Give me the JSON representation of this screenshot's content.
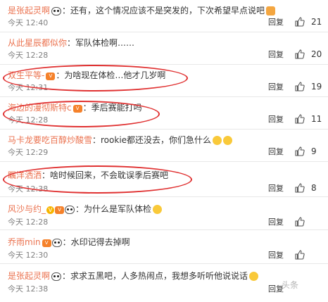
{
  "comments": [
    {
      "user": "是张起灵啊",
      "text": "：还有，这个情况应该不是突发的，下次希望早点说吧",
      "time": "今天 12:40",
      "reply": "回复",
      "likes": "21",
      "badges": [
        "panda"
      ],
      "emoji": "pray"
    },
    {
      "user": "从此星辰都似你",
      "text": "：军队体检啊……",
      "time": "今天 12:28",
      "reply": "回复",
      "likes": "20",
      "badges": [],
      "emoji": ""
    },
    {
      "user": "双生平等-",
      "text": "：为啥现在体检…他才几岁啊",
      "time": "今天 12:31",
      "reply": "回复",
      "likes": "19",
      "badges": [
        "vip"
      ],
      "emoji": ""
    },
    {
      "user": "海边的漫彻斯特c",
      "text": "：季后赛能打吗",
      "time": "今天 12:28",
      "reply": "回复",
      "likes": "11",
      "badges": [
        "vip"
      ],
      "emoji": ""
    },
    {
      "user": "马卡龙要吃百醇炒酸雪",
      "text": "：rookie都还没去，你们急什么",
      "time": "今天 12:29",
      "reply": "回复",
      "likes": "9",
      "badges": [],
      "emoji": "double"
    },
    {
      "user": "瞩洋洒洒",
      "text": "：啥时候回来，不会耽误季后赛吧",
      "time": "今天 12:38",
      "reply": "回复",
      "likes": "8",
      "badges": [],
      "emoji": ""
    },
    {
      "user": "风沙与约_",
      "text": "：为什么是军队体检",
      "time": "今天 12:28",
      "reply": "回复",
      "likes": "",
      "badges": [
        "v",
        "vip",
        "panda"
      ],
      "emoji": "face"
    },
    {
      "user": "乔雨min",
      "text": "：水印记得去掉啊",
      "time": "今天 12:30",
      "reply": "回复",
      "likes": "",
      "badges": [
        "vip",
        "panda"
      ],
      "emoji": ""
    },
    {
      "user": "是张起灵啊",
      "text": "：求求五黑吧，人多热闹点，我想多听听他说说话",
      "time": "今天 12:38",
      "reply": "回复",
      "likes": "",
      "badges": [
        "panda"
      ],
      "emoji": "face"
    }
  ],
  "icons": {
    "like": "thumbs-up-icon"
  },
  "watermark": "头条"
}
